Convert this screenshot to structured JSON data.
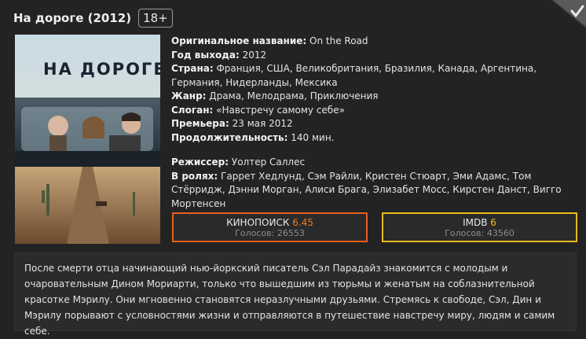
{
  "movie": {
    "title": "На дороге (2012)",
    "age_rating": "18+",
    "poster_title": "НА ДОРОГЕ",
    "original_title_label": "Оригинальное название:",
    "original_title": "On the Road",
    "year_label": "Год выхода:",
    "year": "2012",
    "country_label": "Страна:",
    "country": "Франция, США, Великобритания, Бразилия, Канада, Аргентина, Германия, Нидерланды, Мексика",
    "genre_label": "Жанр:",
    "genre": "Драма, Мелодрама, Приключения",
    "slogan_label": "Слоган:",
    "slogan": "«Навстречу самому себе»",
    "premiere_label": "Премьера:",
    "premiere": "23 мая 2012",
    "duration_label": "Продолжительность:",
    "duration": "140 мин.",
    "director_label": "Режиссер:",
    "director": "Уолтер Саллес",
    "cast_label": "В ролях:",
    "cast": "Гаррет Хедлунд, Сэм Райли, Кристен Стюарт, Эми Адамс, Том Стёрридж, Дэнни Морган, Алиси Брага, Элизабет Мосс, Кирстен Данст, Вигго Мортенсен"
  },
  "ratings": {
    "kinopoisk": {
      "name": "КИНОПОИСК",
      "value": "6.45",
      "votes": "Голосов: 26553",
      "color": "#e6601a"
    },
    "imdb": {
      "name": "IMDB",
      "value": "6",
      "votes": "Голосов: 43560",
      "color": "#e8ba1a"
    }
  },
  "description": "После смерти отца начинающий нью-йоркский писатель Сэл Парадайз знакомится с молодым и очаровательным Дином Мориарти, только что вышедшим из тюрьмы и женатым на соблазнительной красотке Мэрилу. Они мгновенно становятся неразлучными друзьями. Стремясь к свободе, Сэл, Дин и Мэрилу порывают с условностями жизни и отправляются в путешествие навстречу миру, людям и самим себе.",
  "icons": {
    "corner": "checkmark-icon"
  }
}
